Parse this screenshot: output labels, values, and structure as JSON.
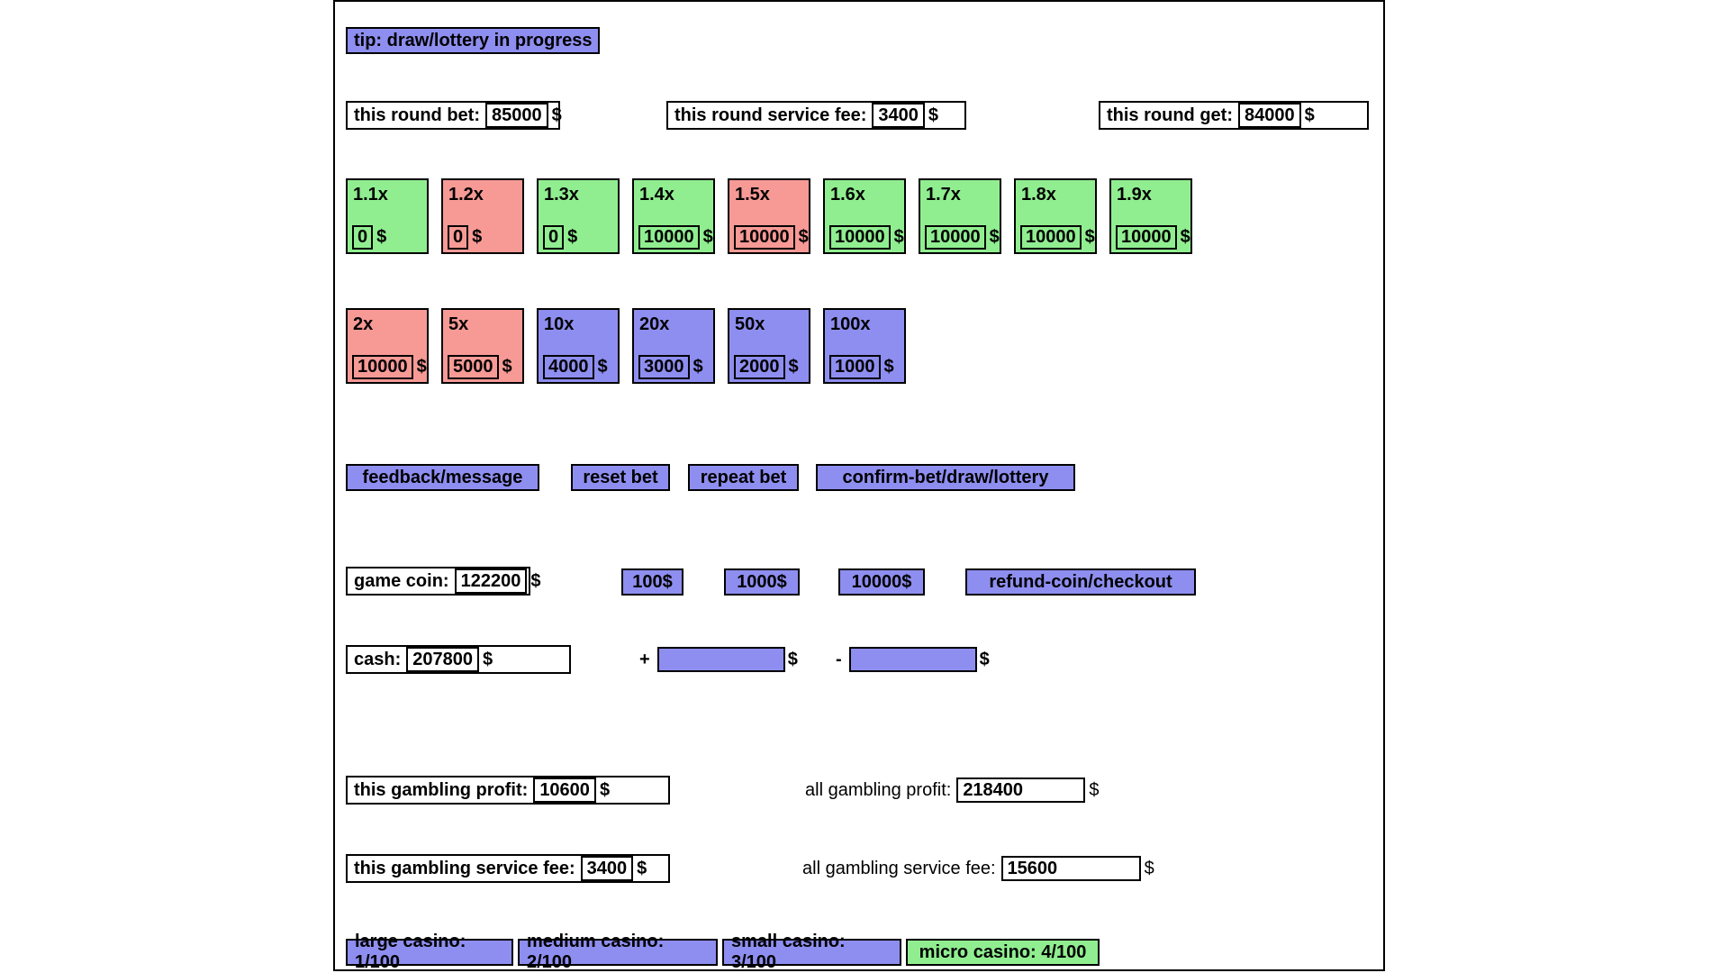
{
  "tip": {
    "text": "tip: draw/lottery in progress"
  },
  "round": {
    "bet_label": "this round bet:",
    "bet_value": "85000",
    "fee_label": "this round service fee:",
    "fee_value": "3400",
    "get_label": "this round get:",
    "get_value": "84000",
    "currency": "$"
  },
  "multipliers_row1": [
    {
      "mult": "1.1x",
      "amount": "0",
      "state": "green"
    },
    {
      "mult": "1.2x",
      "amount": "0",
      "state": "red"
    },
    {
      "mult": "1.3x",
      "amount": "0",
      "state": "green"
    },
    {
      "mult": "1.4x",
      "amount": "10000",
      "state": "green"
    },
    {
      "mult": "1.5x",
      "amount": "10000",
      "state": "red"
    },
    {
      "mult": "1.6x",
      "amount": "10000",
      "state": "green"
    },
    {
      "mult": "1.7x",
      "amount": "10000",
      "state": "green"
    },
    {
      "mult": "1.8x",
      "amount": "10000",
      "state": "green"
    },
    {
      "mult": "1.9x",
      "amount": "10000",
      "state": "green"
    }
  ],
  "multipliers_row2": [
    {
      "mult": "2x",
      "amount": "10000",
      "state": "red"
    },
    {
      "mult": "5x",
      "amount": "5000",
      "state": "red"
    },
    {
      "mult": "10x",
      "amount": "4000",
      "state": "blue"
    },
    {
      "mult": "20x",
      "amount": "3000",
      "state": "blue"
    },
    {
      "mult": "50x",
      "amount": "2000",
      "state": "blue"
    },
    {
      "mult": "100x",
      "amount": "1000",
      "state": "blue"
    }
  ],
  "actions": {
    "feedback": "feedback/message",
    "reset": "reset bet",
    "repeat": "repeat bet",
    "confirm": "confirm-bet/draw/lottery"
  },
  "coin": {
    "label": "game coin:",
    "value": "122200",
    "currency": "$",
    "buy_100": "100$",
    "buy_1000": "1000$",
    "buy_10000": "10000$",
    "refund": "refund-coin/checkout"
  },
  "cash": {
    "label": "cash:",
    "value": "207800",
    "currency": "$",
    "plus_sign": "+",
    "plus_value": "",
    "minus_sign": "-",
    "minus_value": ""
  },
  "profit": {
    "this_label": "this gambling profit:",
    "this_value": "10600",
    "all_label": "all gambling profit:",
    "all_value": "218400",
    "currency": "$"
  },
  "service_fee": {
    "this_label": "this gambling service fee:",
    "this_value": "3400",
    "all_label": "all gambling service fee:",
    "all_value": "15600",
    "currency": "$"
  },
  "casinos": [
    {
      "label": "large casino: 1/100",
      "state": "blue"
    },
    {
      "label": "medium casino: 2/100",
      "state": "blue"
    },
    {
      "label": "small casino: 3/100",
      "state": "blue"
    },
    {
      "label": "micro casino: 4/100",
      "state": "green"
    }
  ],
  "colors": {
    "blue": "#8e8ef0",
    "green": "#90ee90",
    "red": "#f79a96",
    "border": "#000000"
  }
}
